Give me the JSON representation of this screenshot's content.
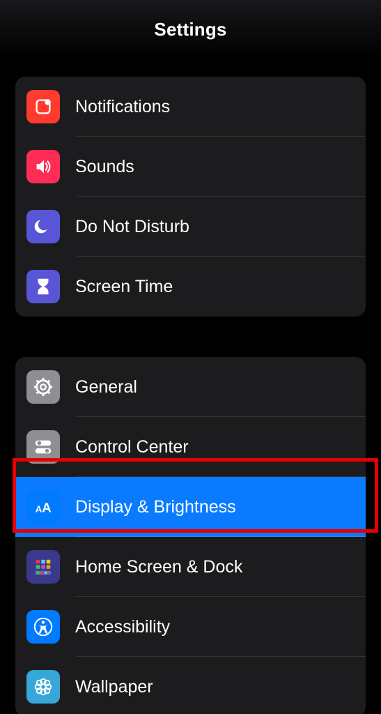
{
  "header": {
    "title": "Settings"
  },
  "group1": {
    "items": [
      {
        "label": "Notifications",
        "icon": "notifications-icon",
        "bg": "bg-red"
      },
      {
        "label": "Sounds",
        "icon": "sounds-icon",
        "bg": "bg-pink"
      },
      {
        "label": "Do Not Disturb",
        "icon": "dnd-icon",
        "bg": "bg-indigo"
      },
      {
        "label": "Screen Time",
        "icon": "screen-time-icon",
        "bg": "bg-indigo"
      }
    ]
  },
  "group2": {
    "items": [
      {
        "label": "General",
        "icon": "general-icon",
        "bg": "bg-gray",
        "selected": false
      },
      {
        "label": "Control Center",
        "icon": "control-center-icon",
        "bg": "bg-gray",
        "selected": false
      },
      {
        "label": "Display & Brightness",
        "icon": "display-brightness-icon",
        "bg": "bg-blue",
        "selected": true
      },
      {
        "label": "Home Screen & Dock",
        "icon": "home-screen-icon",
        "bg": "bg-darkblueicons",
        "selected": false
      },
      {
        "label": "Accessibility",
        "icon": "accessibility-icon",
        "bg": "bg-blue",
        "selected": false
      },
      {
        "label": "Wallpaper",
        "icon": "wallpaper-icon",
        "bg": "bg-blue",
        "selected": false
      }
    ]
  },
  "annotation": {
    "highlighted_item": "Display & Brightness"
  }
}
